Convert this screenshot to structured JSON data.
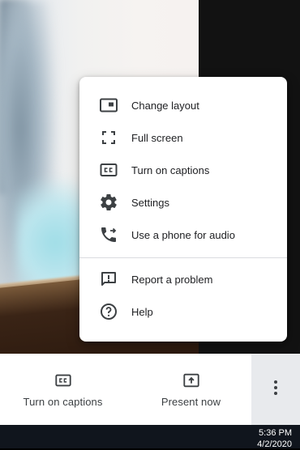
{
  "menu": {
    "items": [
      {
        "label": "Change layout",
        "icon": "layout-icon"
      },
      {
        "label": "Full screen",
        "icon": "fullscreen-icon"
      },
      {
        "label": "Turn on captions",
        "icon": "closed-captions-icon"
      },
      {
        "label": "Settings",
        "icon": "gear-icon"
      },
      {
        "label": "Use a phone for audio",
        "icon": "phone-audio-icon"
      },
      {
        "label": "Report a problem",
        "icon": "report-icon"
      },
      {
        "label": "Help",
        "icon": "help-icon"
      }
    ]
  },
  "bottom_bar": {
    "captions_label": "Turn on captions",
    "present_label": "Present now",
    "more_icon": "more-vert-icon"
  },
  "taskbar": {
    "time": "5:36 PM",
    "date": "4/2/2020"
  },
  "colors": {
    "icon": "#3c4043",
    "text": "#202124",
    "more_bg": "#e8eaed"
  }
}
